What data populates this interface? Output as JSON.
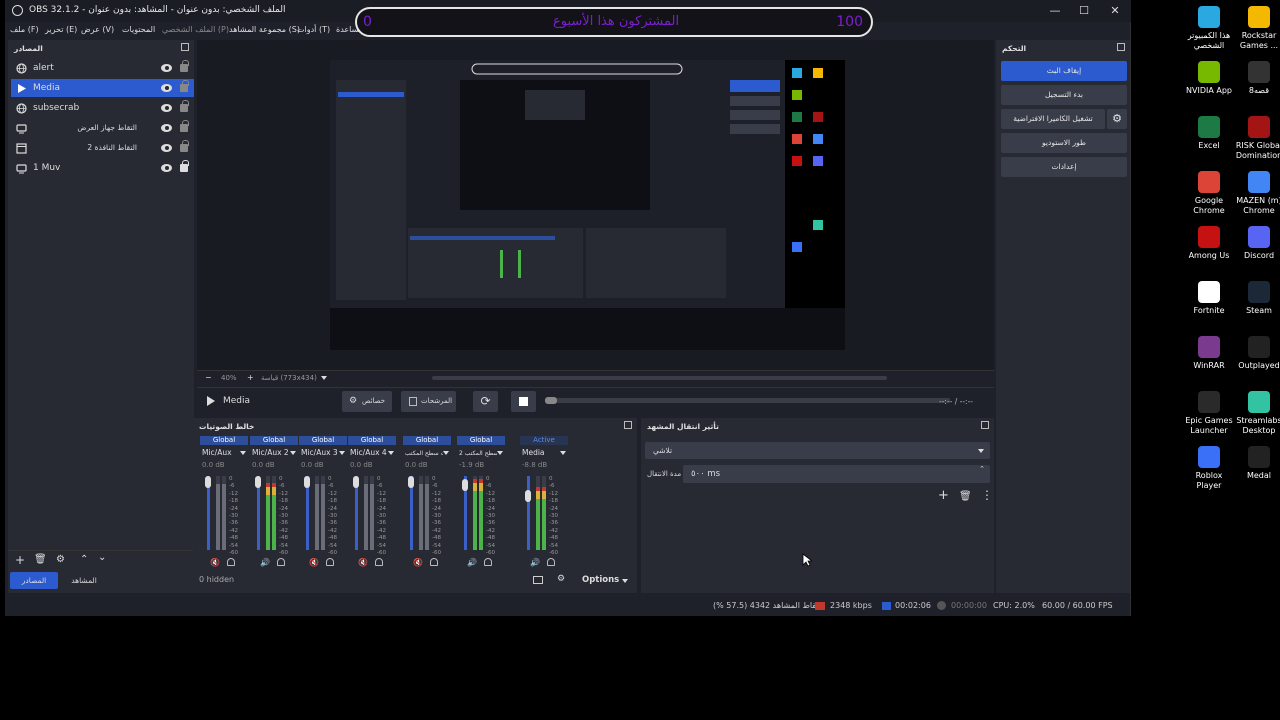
{
  "window": {
    "title": "OBS 32.1.2 - الملف الشخصي: بدون عنوان - المشاهد: بدون عنوان",
    "minimize": "—",
    "maximize": "☐",
    "close": "✕"
  },
  "menu": {
    "file": "ملف (F)",
    "edit": "تحرير (E)",
    "view": "عرض (V)",
    "docks": "المحتويات",
    "profile": "الملف الشخصي (P)",
    "scene_collection": "مجموعة المشاهد (S)",
    "tools": "أدوات (T)",
    "help": "مساعدة (H)"
  },
  "overlay": {
    "left_value": "0",
    "center_text": "المشتركون هذا الأسبوع",
    "right_value": "100"
  },
  "sources_dock": {
    "title": "المصادر",
    "items": [
      {
        "label": "alert",
        "icon": "globe-icon",
        "selected": false,
        "locked": false
      },
      {
        "label": "Media",
        "icon": "play-icon",
        "selected": true,
        "locked": false
      },
      {
        "label": "subsecrab",
        "icon": "globe-icon",
        "selected": false,
        "locked": false
      },
      {
        "label": "التقاط جهاز العرض",
        "icon": "monitor-icon",
        "selected": false,
        "locked": false
      },
      {
        "label": "التقاط النافذة 2",
        "icon": "window-icon",
        "selected": false,
        "locked": false
      },
      {
        "label": "1 Muv",
        "icon": "monitor-icon",
        "selected": false,
        "locked": true
      }
    ],
    "tab_sources": "المصادر",
    "tab_scenes": "المشاهد"
  },
  "preview": {
    "zoom": "40%",
    "canvas_label": "قياسة (773x434)"
  },
  "media_controls": {
    "source_name": "Media",
    "properties": "خصائص",
    "filters": "المرشحات",
    "time": "--:-- / --:--"
  },
  "mixer": {
    "title": "خالط الصوتيات",
    "hidden_label": "0 hidden",
    "options_label": "Options",
    "channels": [
      {
        "badge": "Global",
        "name": "Mic/Aux",
        "db": "0.0 dB",
        "level": 0
      },
      {
        "badge": "Global",
        "name": "Mic/Aux 2",
        "db": "0.0 dB",
        "level": 0.85
      },
      {
        "badge": "Global",
        "name": "Mic/Aux 3",
        "db": "0.0 dB",
        "level": 0
      },
      {
        "badge": "Global",
        "name": "Mic/Aux 4",
        "db": "0.0 dB",
        "level": 0
      },
      {
        "badge": "Global",
        "name": "صوت سطح المكتب",
        "db": "0.0 dB",
        "level": 0
      },
      {
        "badge": "Global",
        "name": "صوت سطح المكتب 2",
        "db": "-1.9 dB",
        "level": 0.9
      },
      {
        "badge": "Active",
        "name": "Media",
        "db": "-8.8 dB",
        "level": 0.8
      }
    ],
    "scale": [
      "0",
      "-6",
      "-12",
      "-18",
      "-24",
      "-30",
      "-36",
      "-42",
      "-48",
      "-54",
      "-60"
    ]
  },
  "transitions": {
    "title": "تأثير انتقال المشهد",
    "selected": "تلاشي",
    "duration_label": "مدة الانتقال",
    "duration_value": "٥٠٠ ms"
  },
  "controls": {
    "title": "التحكم",
    "stop_stream": "إيقاف البث",
    "start_recording": "بدء التسجيل",
    "virtual_camera": "تشغيل الكاميرا الافتراضية",
    "studio_mode": "طور الاستوديو",
    "settings": "إعدادات"
  },
  "status": {
    "dropped": "إسقاط المشاهد 4342 (57.5 %)",
    "bitrate": "2348 kbps",
    "stream_time": "00:02:06",
    "rec_time": "00:00:00",
    "cpu": "CPU: 2.0%",
    "fps": "60.00 / 60.00 FPS"
  },
  "desktop_icons": [
    {
      "label": "هذا الكمبيوتر الشخصي",
      "color": "#2aa9e0"
    },
    {
      "label": "Rockstar Games ...",
      "color": "#f5b800"
    },
    {
      "label": "NVIDIA App",
      "color": "#76b900"
    },
    {
      "label": "8قصه",
      "color": "#333333"
    },
    {
      "label": "Excel",
      "color": "#1d7a45"
    },
    {
      "label": "RISK Global Domination",
      "color": "#a31515"
    },
    {
      "label": "Google Chrome",
      "color": "#db4437"
    },
    {
      "label": "MAZEN (m) Chrome",
      "color": "#4285f4"
    },
    {
      "label": "Among Us",
      "color": "#c51111"
    },
    {
      "label": "Discord",
      "color": "#5865f2"
    },
    {
      "label": "Fortnite",
      "color": "#ffffff"
    },
    {
      "label": "Steam",
      "color": "#1b2838"
    },
    {
      "label": "WinRAR",
      "color": "#7a3b8f"
    },
    {
      "label": "Outplayed",
      "color": "#222222"
    },
    {
      "label": "Epic Games Launcher",
      "color": "#2a2a2a"
    },
    {
      "label": "Streamlabs Desktop",
      "color": "#31c3a2"
    },
    {
      "label": "Roblox Player",
      "color": "#3a6ff7"
    },
    {
      "label": "Medal",
      "color": "#222222"
    }
  ]
}
